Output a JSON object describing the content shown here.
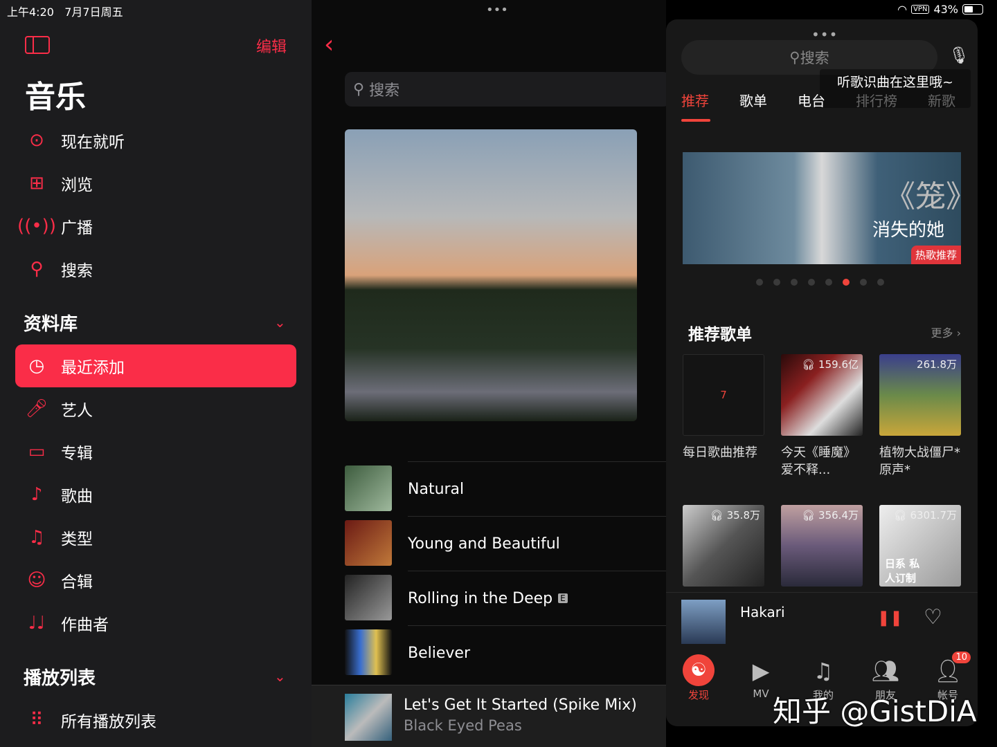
{
  "status": {
    "time": "上午4:20",
    "date": "7月7日周五",
    "vpn": "VPN",
    "battery": "43%",
    "battery_level": 0.43
  },
  "sidebar": {
    "edit": "编辑",
    "title": "音乐",
    "items": [
      {
        "label": "现在就听",
        "icon": "play-circle-icon"
      },
      {
        "label": "浏览",
        "icon": "grid-icon"
      },
      {
        "label": "广播",
        "icon": "radio-icon"
      },
      {
        "label": "搜索",
        "icon": "search-icon"
      }
    ],
    "library_title": "资料库",
    "library": [
      {
        "label": "最近添加",
        "icon": "clock-icon",
        "active": true
      },
      {
        "label": "艺人",
        "icon": "microphone-icon"
      },
      {
        "label": "专辑",
        "icon": "album-icon"
      },
      {
        "label": "歌曲",
        "icon": "note-icon"
      },
      {
        "label": "类型",
        "icon": "genre-icon"
      },
      {
        "label": "合辑",
        "icon": "compilation-icon"
      },
      {
        "label": "作曲者",
        "icon": "composer-icon"
      }
    ],
    "playlists_title": "播放列表",
    "playlists": [
      {
        "label": "所有播放列表",
        "icon": "grid-icon"
      }
    ]
  },
  "middle": {
    "search_placeholder": "搜索",
    "songs": [
      {
        "title": "Natural"
      },
      {
        "title": "Young and Beautiful"
      },
      {
        "title": "Rolling in the Deep",
        "explicit": "E"
      },
      {
        "title": "Believer"
      }
    ],
    "now_playing": {
      "title": "Let's Get It Started (Spike Mix)",
      "artist": "Black Eyed Peas"
    }
  },
  "panel": {
    "search_placeholder": "搜索",
    "tooltip": "听歌识曲在这里哦~",
    "tabs": [
      "推荐",
      "歌单",
      "电台",
      "排行榜",
      "新歌"
    ],
    "banner": {
      "title": "《笼》",
      "subtitle": "消失的她",
      "tag": "热歌推荐"
    },
    "pager_count": 8,
    "pager_active": 5,
    "section_title": "推荐歌单",
    "more": "更多 ›",
    "cards": [
      {
        "cover": "7",
        "name": "每日歌曲推荐"
      },
      {
        "plays": "159.6亿",
        "name": "今天《睡魔》爱不释..."
      },
      {
        "plays": "261.8万",
        "name": "植物大战僵尸*原声*"
      },
      {
        "plays": "35.8万"
      },
      {
        "plays": "356.4万"
      },
      {
        "plays": "6301.7万",
        "cover_text": "日系 私人订制"
      }
    ],
    "now_playing": {
      "title": "Hakari"
    },
    "bottom_tabs": [
      {
        "label": "发现",
        "active": true
      },
      {
        "label": "MV"
      },
      {
        "label": "我的"
      },
      {
        "label": "朋友"
      },
      {
        "label": "帐号",
        "badge": "10"
      }
    ]
  },
  "watermark": "知乎 @GistDiA",
  "colors": {
    "accent": "#fa2d48",
    "netease_red": "#f0443b"
  }
}
